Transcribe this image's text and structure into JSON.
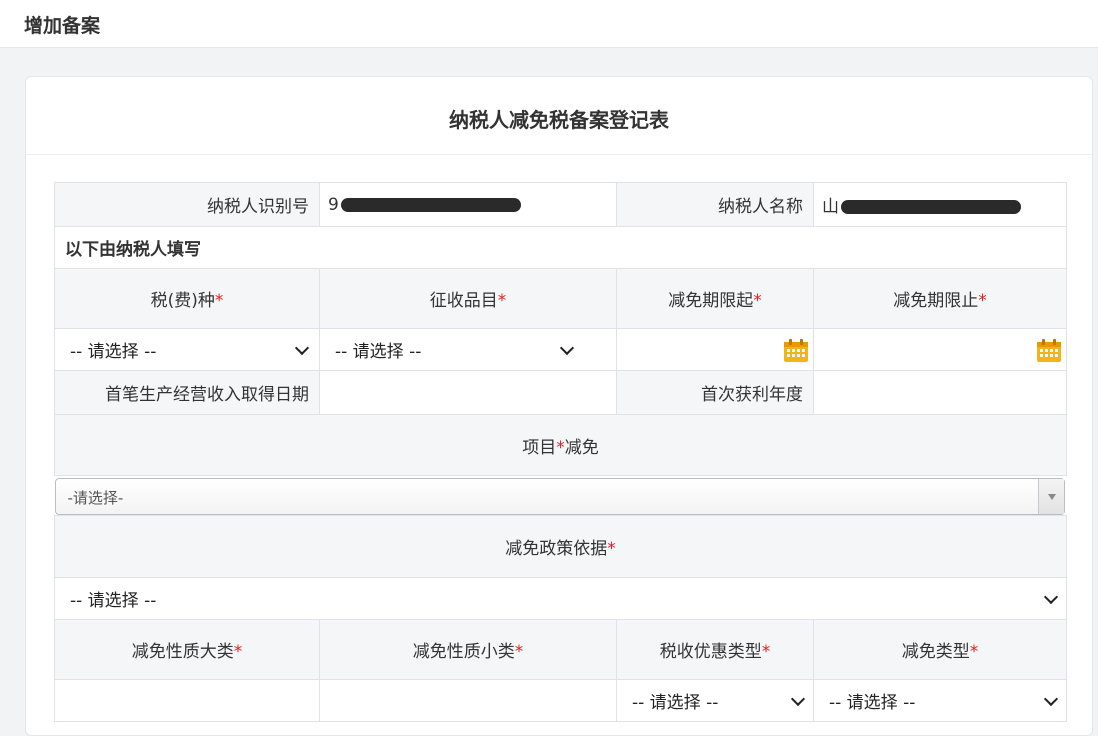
{
  "header": {
    "title": "增加备案"
  },
  "card": {
    "title": "纳税人减免税备案登记表"
  },
  "taxpayer": {
    "id_label": "纳税人识别号",
    "id_value": "9",
    "name_label": "纳税人名称",
    "name_value": "山"
  },
  "section_title": "以下由纳税人填写",
  "cols": {
    "tax_type": "税(费)种",
    "item": "征收品目",
    "start": "减免期限起",
    "end": "减免期限止"
  },
  "placeholders": {
    "select": "-- 请选择 --",
    "select2": "-请选择-"
  },
  "labels": {
    "first_income_date": "首笔生产经营收入取得日期",
    "first_profit_year": "首次获利年度",
    "project_a": "项目",
    "project_b": "减免",
    "policy_basis": "减免政策依据",
    "nature_major": "减免性质大类",
    "nature_minor": "减免性质小类",
    "preference_type": "税收优惠类型",
    "exemption_type": "减免类型"
  },
  "required_mark": "*",
  "colors": {
    "required": "#e02020",
    "calendar": "#f0a500"
  },
  "icons": [
    "calendar-icon",
    "chevron-down-icon"
  ]
}
